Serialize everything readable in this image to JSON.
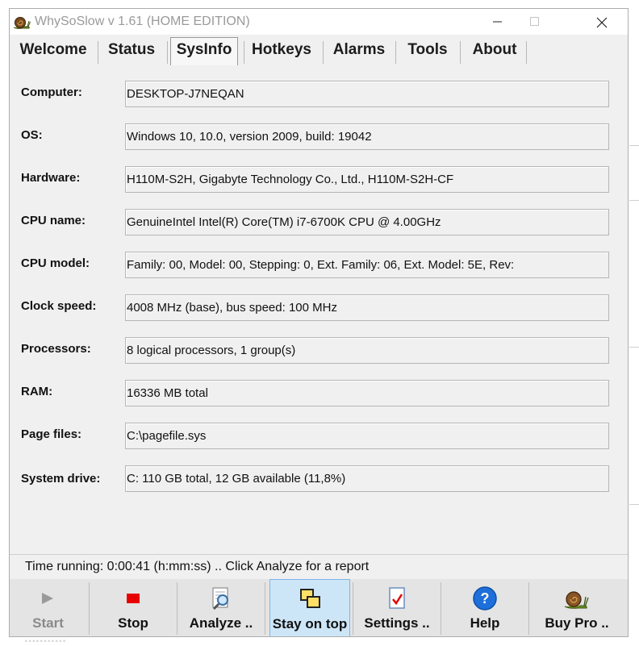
{
  "window": {
    "title": "WhySoSlow v 1.61  (HOME EDITION)"
  },
  "tabs": [
    {
      "label": "Welcome"
    },
    {
      "label": "Status"
    },
    {
      "label": "SysInfo",
      "active": true
    },
    {
      "label": "Hotkeys"
    },
    {
      "label": "Alarms"
    },
    {
      "label": "Tools"
    },
    {
      "label": "About"
    }
  ],
  "sysinfo": {
    "rows": [
      {
        "label": "Computer:",
        "value": "DESKTOP-J7NEQAN"
      },
      {
        "label": "OS:",
        "value": "Windows 10, 10.0, version 2009, build: 19042"
      },
      {
        "label": "Hardware:",
        "value": "H110M-S2H, Gigabyte Technology Co., Ltd., H110M-S2H-CF"
      },
      {
        "label": "CPU name:",
        "value": "GenuineIntel Intel(R) Core(TM) i7-6700K CPU @ 4.00GHz"
      },
      {
        "label": "CPU model:",
        "value": "Family: 00, Model: 00, Stepping: 0, Ext. Family: 06, Ext. Model: 5E, Rev:"
      },
      {
        "label": "Clock speed:",
        "value": "4008 MHz (base),  bus speed: 100 MHz"
      },
      {
        "label": "Processors:",
        "value": "8 logical processors, 1 group(s)"
      },
      {
        "label": "RAM:",
        "value": "16336 MB total"
      },
      {
        "label": "Page files:",
        "value": "C:\\pagefile.sys"
      },
      {
        "label": "System drive:",
        "value": "C:  110 GB total, 12 GB available (11,8%)"
      }
    ]
  },
  "status": {
    "text": "Time running: 0:00:41  (h:mm:ss) ..  Click Analyze for a report"
  },
  "toolbar": {
    "start": "Start",
    "stop": "Stop",
    "analyze": "Analyze ..",
    "stay_on_top": "Stay on top",
    "settings": "Settings ..",
    "help": "Help",
    "buy_pro": "Buy Pro .."
  },
  "background": {
    "partial_text": "..........."
  },
  "colors": {
    "window_bg": "#f0f0f0",
    "toolbar_bg": "#e4e4e4",
    "active_toolbar_bg": "#cde6f7",
    "stop_red": "#e60000",
    "help_blue": "#1e6fd9"
  },
  "icons": {
    "title": "snail-icon",
    "start": "play-icon",
    "stop": "stop-square-icon",
    "analyze": "magnifier-document-icon",
    "stay_on_top": "overlapping-windows-icon",
    "settings": "checklist-icon",
    "help": "help-circle-icon",
    "buy_pro": "snail-icon"
  }
}
